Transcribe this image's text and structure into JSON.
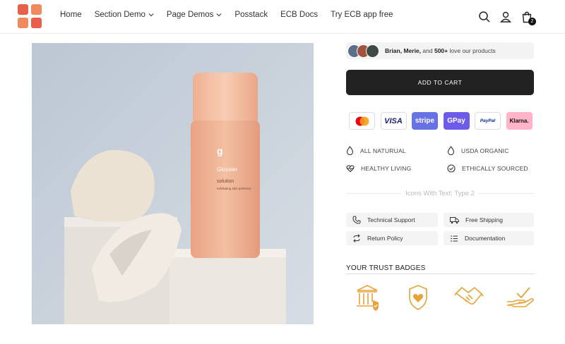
{
  "nav": {
    "items": [
      {
        "label": "Home",
        "dropdown": false
      },
      {
        "label": "Section Demo",
        "dropdown": true
      },
      {
        "label": "Page Demos",
        "dropdown": true
      },
      {
        "label": "Posstack",
        "dropdown": false
      },
      {
        "label": "ECB Docs",
        "dropdown": false
      },
      {
        "label": "Try ECB app free",
        "dropdown": false
      }
    ]
  },
  "cart": {
    "count": "2"
  },
  "product": {
    "brand_text": "Glossier",
    "name_text": "solution",
    "sub_text": "exfoliating skin perfector"
  },
  "social_proof": {
    "names": "Brian, Merie,",
    "and": "and",
    "count": "500+",
    "suffix": "love our products"
  },
  "add_to_cart_label": "ADD TO CART",
  "payments": [
    {
      "name": "Mastercard",
      "icon": "mastercard-icon"
    },
    {
      "name": "VISA",
      "icon": "visa-icon"
    },
    {
      "name": "stripe",
      "icon": "stripe-icon"
    },
    {
      "name": "GPay",
      "icon": "gpay-icon"
    },
    {
      "name": "PayPal",
      "icon": "paypal-icon"
    },
    {
      "name": "Klarna.",
      "icon": "klarna-icon"
    }
  ],
  "features": [
    {
      "label": "ALL NATURUAL",
      "icon": "drop-icon"
    },
    {
      "label": "USDA ORGANIC",
      "icon": "drop-icon"
    },
    {
      "label": "HEALTHY LIVING",
      "icon": "heartbeat-icon"
    },
    {
      "label": "ETHICALLY SOURCED",
      "icon": "check-circle-icon"
    }
  ],
  "icons_section_title": "Icons With Text: Type 2",
  "icon_pills": [
    {
      "label": "Technical Support",
      "icon": "phone-icon"
    },
    {
      "label": "Free Shipping",
      "icon": "truck-icon"
    },
    {
      "label": "Return Policy",
      "icon": "refresh-icon"
    },
    {
      "label": "Documentation",
      "icon": "list-icon"
    }
  ],
  "trust_badges_title": "YOUR TRUST BADGES",
  "trust_badges": [
    {
      "icon": "bank-shield-icon"
    },
    {
      "icon": "heart-shield-icon"
    },
    {
      "icon": "handshake-icon"
    },
    {
      "icon": "hand-check-icon"
    }
  ],
  "colors": {
    "accent": "#e8a23a",
    "button": "#222222",
    "logo_red": "#e8604c",
    "logo_orange": "#f08a5d"
  }
}
